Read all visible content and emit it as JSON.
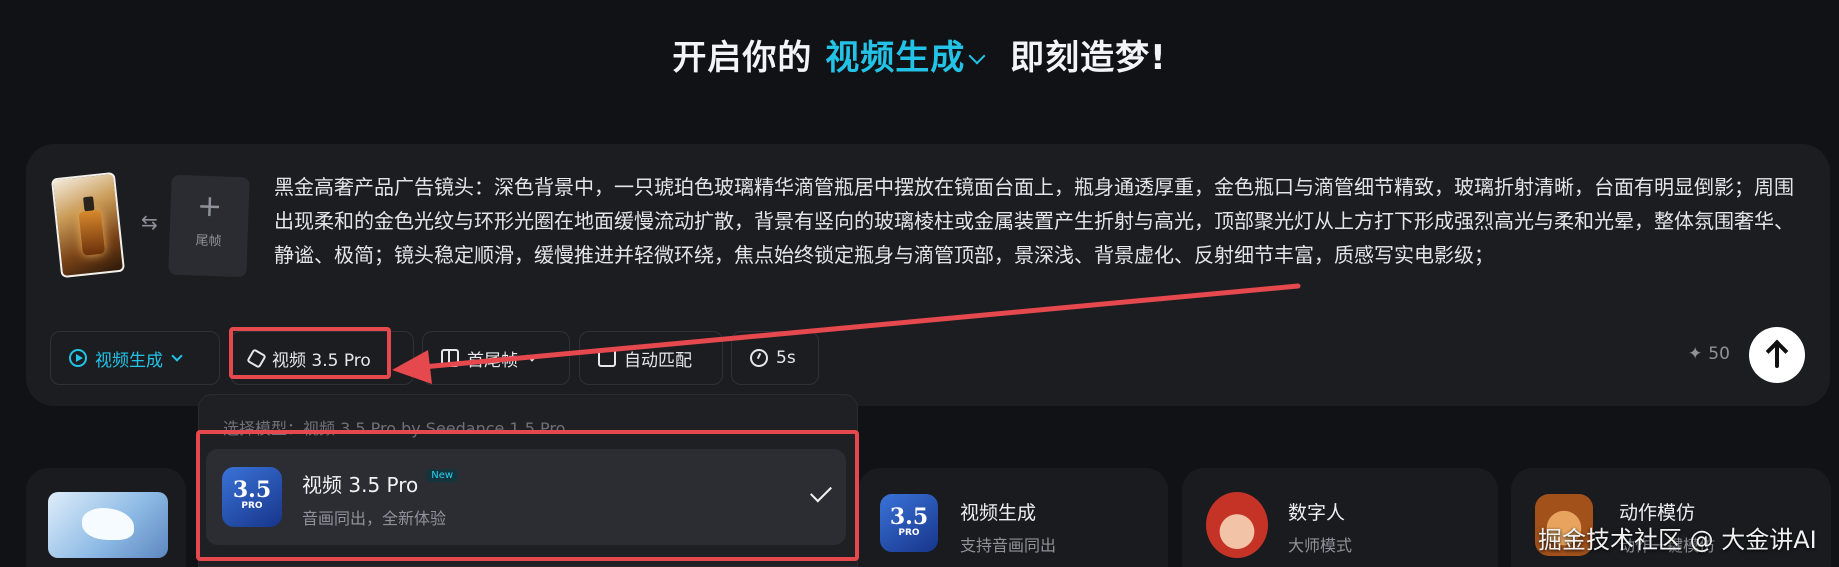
{
  "headline": {
    "prefix": "开启你的",
    "mode": "视频生成",
    "suffix": "即刻造梦!"
  },
  "composer": {
    "end_frame_label": "尾帧",
    "prompt": "黑金高奢产品广告镜头：深色背景中，一只琥珀色玻璃精华滴管瓶居中摆放在镜面台面上，瓶身通透厚重，金色瓶口与滴管细节精致，玻璃折射清晰，台面有明显倒影；周围出现柔和的金色光纹与环形光圈在地面缓慢流动扩散，背景有竖向的玻璃棱柱或金属装置产生折射与高光，顶部聚光灯从上方打下形成强烈高光与柔和光晕，整体氛围奢华、静谧、极简；镜头稳定顺滑，缓慢推进并轻微环绕，焦点始终锁定瓶身与滴管顶部，景深浅、背景虚化、反射细节丰富，质感写实电影级；"
  },
  "toolbar": {
    "mode_label": "视频生成",
    "model_label": "视频 3.5 Pro",
    "frame_label": "首尾帧",
    "ratio_label": "自动匹配",
    "duration_label": "5s",
    "credits": "50"
  },
  "dropdown": {
    "header": "选择模型：视频 3.5 Pro by Seedance 1.5 Pro",
    "option": {
      "icon_num": "3.5",
      "icon_pro": "PRO",
      "title": "视频 3.5 Pro",
      "badge": "New",
      "subtitle": "音画同出，全新体验"
    }
  },
  "cards": [
    {
      "title": "视频生成",
      "subtitle": "支持音画同出",
      "icon_num": "3.5",
      "icon_pro": "PRO"
    },
    {
      "title": "数字人",
      "subtitle": "大师模式"
    },
    {
      "title": "动作模仿",
      "subtitle": "动作一键模仿"
    }
  ],
  "watermark": "掘金技术社区 @ 大金讲AI",
  "colors": {
    "accent": "#22c3e6",
    "highlight": "#e5484d",
    "panel": "#1c1d21"
  }
}
